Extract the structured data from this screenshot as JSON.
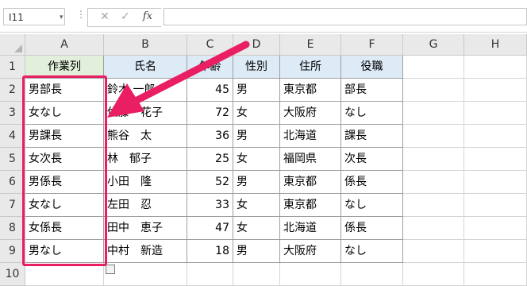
{
  "formula_bar": {
    "name_box": "I11",
    "menu_dots": "⋮",
    "cancel_glyph": "✕",
    "enter_glyph": "✓",
    "fx_label": "fx",
    "formula": ""
  },
  "columns": [
    "A",
    "B",
    "C",
    "D",
    "E",
    "F",
    "G",
    "H"
  ],
  "rows": [
    "1",
    "2",
    "3",
    "4",
    "5",
    "6",
    "7",
    "8",
    "9",
    "10"
  ],
  "table": {
    "headers": [
      "作業列",
      "氏名",
      "年齢",
      "性別",
      "住所",
      "役職"
    ],
    "header_colors": {
      "A": "#e2efda",
      "other": "#ddebf7"
    },
    "data": [
      [
        "男部長",
        "鈴木 一郎",
        "45",
        "男",
        "東京都",
        "部長"
      ],
      [
        "女なし",
        "佐藤　花子",
        "72",
        "女",
        "大阪府",
        "なし"
      ],
      [
        "男課長",
        "熊谷　太",
        "36",
        "男",
        "北海道",
        "課長"
      ],
      [
        "女次長",
        "林　郁子",
        "25",
        "女",
        "福岡県",
        "次長"
      ],
      [
        "男係長",
        "小田　隆",
        "52",
        "男",
        "東京都",
        "係長"
      ],
      [
        "女なし",
        "左田　忍",
        "33",
        "女",
        "東京都",
        "なし"
      ],
      [
        "女係長",
        "田中　恵子",
        "47",
        "女",
        "北海道",
        "係長"
      ],
      [
        "男なし",
        "中村　新造",
        "18",
        "男",
        "大阪府",
        "なし"
      ]
    ]
  },
  "annotation": {
    "color": "#e91e63"
  }
}
